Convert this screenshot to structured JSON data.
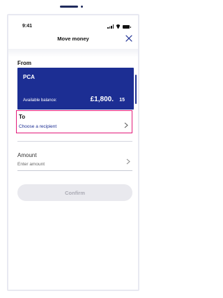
{
  "status_bar": {
    "time": "9:41"
  },
  "header": {
    "title": "Move money"
  },
  "from": {
    "label": "From",
    "account": {
      "name": "PCA",
      "balance_label": "Available balance:",
      "balance_main": "£1,800.",
      "balance_pence": "15"
    }
  },
  "to": {
    "label": "To",
    "value": "Choose a recipient"
  },
  "amount": {
    "label": "Amount",
    "placeholder": "Enter amount"
  },
  "confirm": {
    "label": "Confirm"
  },
  "colors": {
    "brand": "#1c2e93",
    "highlight": "#e3197a",
    "disabled_button": "#e9e9ee",
    "disabled_text": "#aaaab4"
  },
  "icons": [
    "signal-icon",
    "wifi-icon",
    "battery-icon",
    "close-icon",
    "chevron-right-icon"
  ]
}
